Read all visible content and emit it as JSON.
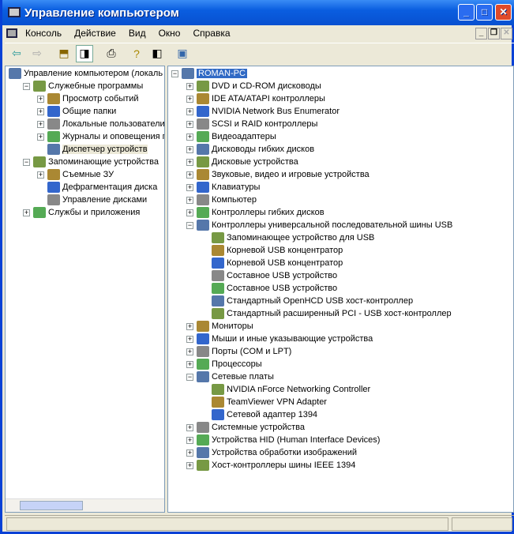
{
  "window": {
    "title": "Управление компьютером",
    "min": "_",
    "max": "□",
    "close": "✕"
  },
  "menu": [
    "Консоль",
    "Действие",
    "Вид",
    "Окно",
    "Справка"
  ],
  "left_tree": [
    {
      "label": "Управление компьютером (локаль",
      "depth": 0,
      "exp": ""
    },
    {
      "label": "Служебные программы",
      "depth": 1,
      "exp": "−"
    },
    {
      "label": "Просмотр событий",
      "depth": 2,
      "exp": "+"
    },
    {
      "label": "Общие папки",
      "depth": 2,
      "exp": "+"
    },
    {
      "label": "Локальные пользователи",
      "depth": 2,
      "exp": "+"
    },
    {
      "label": "Журналы и оповещения пр",
      "depth": 2,
      "exp": "+"
    },
    {
      "label": "Диспетчер устройств",
      "depth": 2,
      "exp": "",
      "selected": true
    },
    {
      "label": "Запоминающие устройства",
      "depth": 1,
      "exp": "−"
    },
    {
      "label": "Съемные ЗУ",
      "depth": 2,
      "exp": "+"
    },
    {
      "label": "Дефрагментация диска",
      "depth": 2,
      "exp": ""
    },
    {
      "label": "Управление дисками",
      "depth": 2,
      "exp": ""
    },
    {
      "label": "Службы и приложения",
      "depth": 1,
      "exp": "+"
    }
  ],
  "right_tree": [
    {
      "label": "ROMAN-PC",
      "depth": 0,
      "exp": "−",
      "selected": true
    },
    {
      "label": "DVD и CD-ROM дисководы",
      "depth": 1,
      "exp": "+"
    },
    {
      "label": "IDE ATA/ATAPI контроллеры",
      "depth": 1,
      "exp": "+"
    },
    {
      "label": "NVIDIA Network Bus Enumerator",
      "depth": 1,
      "exp": "+"
    },
    {
      "label": "SCSI и RAID контроллеры",
      "depth": 1,
      "exp": "+"
    },
    {
      "label": "Видеоадаптеры",
      "depth": 1,
      "exp": "+"
    },
    {
      "label": "Дисководы гибких дисков",
      "depth": 1,
      "exp": "+"
    },
    {
      "label": "Дисковые устройства",
      "depth": 1,
      "exp": "+"
    },
    {
      "label": "Звуковые, видео и игровые устройства",
      "depth": 1,
      "exp": "+"
    },
    {
      "label": "Клавиатуры",
      "depth": 1,
      "exp": "+"
    },
    {
      "label": "Компьютер",
      "depth": 1,
      "exp": "+"
    },
    {
      "label": "Контроллеры гибких дисков",
      "depth": 1,
      "exp": "+"
    },
    {
      "label": "Контроллеры универсальной последовательной шины USB",
      "depth": 1,
      "exp": "−"
    },
    {
      "label": "Запоминающее устройство для USB",
      "depth": 2,
      "exp": ""
    },
    {
      "label": "Корневой USB концентратор",
      "depth": 2,
      "exp": ""
    },
    {
      "label": "Корневой USB концентратор",
      "depth": 2,
      "exp": ""
    },
    {
      "label": "Составное USB устройство",
      "depth": 2,
      "exp": ""
    },
    {
      "label": "Составное USB устройство",
      "depth": 2,
      "exp": ""
    },
    {
      "label": "Стандартный OpenHCD USB хост-контроллер",
      "depth": 2,
      "exp": ""
    },
    {
      "label": "Стандартный расширенный PCI - USB хост-контроллер",
      "depth": 2,
      "exp": ""
    },
    {
      "label": "Мониторы",
      "depth": 1,
      "exp": "+"
    },
    {
      "label": "Мыши и иные указывающие устройства",
      "depth": 1,
      "exp": "+"
    },
    {
      "label": "Порты (COM и LPT)",
      "depth": 1,
      "exp": "+"
    },
    {
      "label": "Процессоры",
      "depth": 1,
      "exp": "+"
    },
    {
      "label": "Сетевые платы",
      "depth": 1,
      "exp": "−"
    },
    {
      "label": "NVIDIA nForce Networking Controller",
      "depth": 2,
      "exp": ""
    },
    {
      "label": "TeamViewer VPN Adapter",
      "depth": 2,
      "exp": ""
    },
    {
      "label": "Сетевой адаптер 1394",
      "depth": 2,
      "exp": ""
    },
    {
      "label": "Системные устройства",
      "depth": 1,
      "exp": "+"
    },
    {
      "label": "Устройства HID (Human Interface Devices)",
      "depth": 1,
      "exp": "+"
    },
    {
      "label": "Устройства обработки изображений",
      "depth": 1,
      "exp": "+"
    },
    {
      "label": "Хост-контроллеры шины IEEE 1394",
      "depth": 1,
      "exp": "+"
    }
  ]
}
